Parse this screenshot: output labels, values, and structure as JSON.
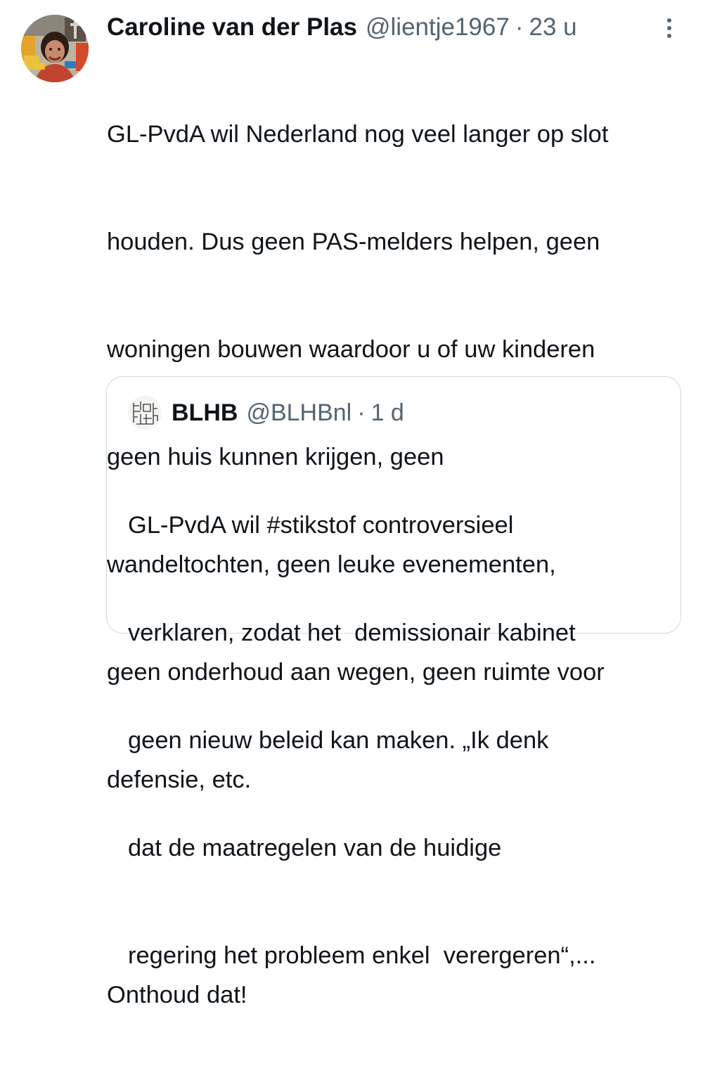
{
  "tweet": {
    "author": {
      "name": "Caroline van der Plas",
      "handle": "@lientje1967",
      "avatar_icon": "profile-photo"
    },
    "separator": "·",
    "time": "23 u",
    "more_icon": "more-vertical-icon",
    "lines": [
      "GL-PvdA wil Nederland nog veel langer op slot",
      "houden. Dus geen PAS-melders helpen, geen",
      "woningen bouwen waardoor u of uw kinderen",
      "geen huis kunnen krijgen, geen",
      "wandeltochten, geen leuke evenementen,",
      "geen onderhoud aan wegen, geen ruimte voor",
      "defensie, etc.",
      "",
      "Onthoud dat!"
    ]
  },
  "quote": {
    "author": {
      "name": "BLHB",
      "handle": "@BLHBnl",
      "avatar_icon": "blhb-logo"
    },
    "separator": "·",
    "time": "1 d",
    "lines": [
      "GL-PvdA wil #stikstof controversieel",
      "verklaren, zodat het  demissionair kabinet",
      "geen nieuw beleid kan maken. „Ik denk",
      "dat de maatregelen van de huidige",
      "regering het probleem enkel  verergeren“,..."
    ]
  },
  "colors": {
    "text": "#0f1419",
    "secondary": "#536471",
    "border": "#cfd9de"
  }
}
